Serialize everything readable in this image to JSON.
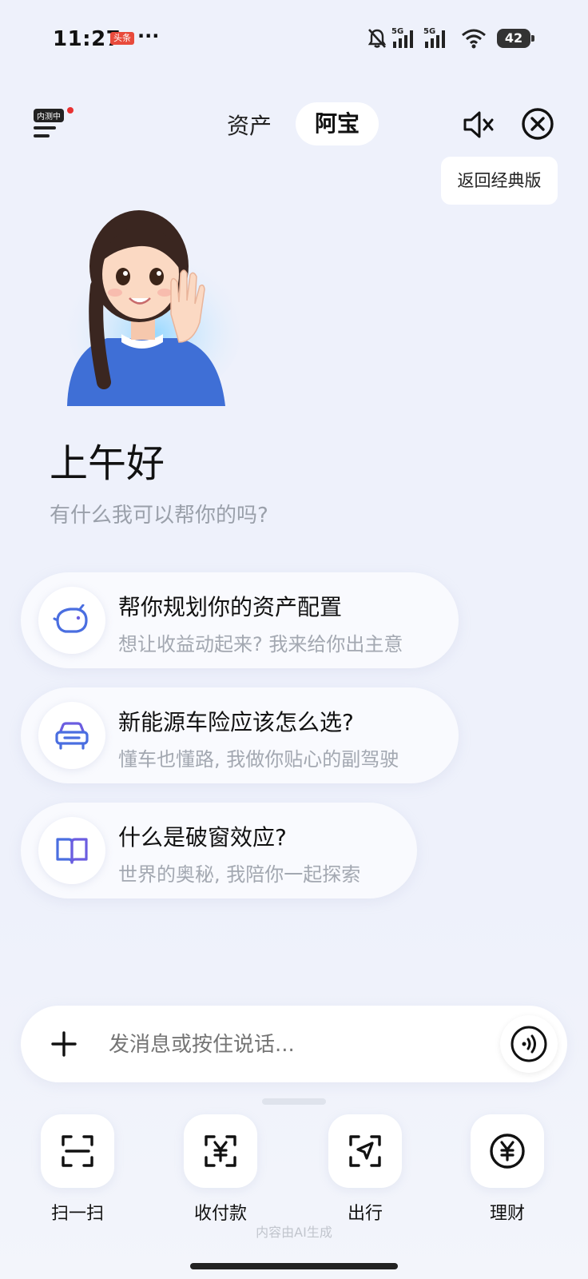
{
  "status": {
    "time": "11:27",
    "news_badge": "头条",
    "dots": "···",
    "battery": "42"
  },
  "nav": {
    "beta_badge": "内测中",
    "tab_assets": "资产",
    "tab_abao": "阿宝",
    "tooltip": "返回经典版"
  },
  "greeting": {
    "title": "上午好",
    "subtitle": "有什么我可以帮你的吗?"
  },
  "cards": [
    {
      "icon": "piggy-bank-icon",
      "title": "帮你规划你的资产配置",
      "subtitle": "想让收益动起来? 我来给你出主意"
    },
    {
      "icon": "car-icon",
      "title": "新能源车险应该怎么选?",
      "subtitle": "懂车也懂路, 我做你贴心的副驾驶"
    },
    {
      "icon": "book-icon",
      "title": "什么是破窗效应?",
      "subtitle": "世界的奥秘, 我陪你一起探索"
    }
  ],
  "input": {
    "placeholder": "发消息或按住说话..."
  },
  "shortcuts": [
    {
      "icon": "scan-icon",
      "label": "扫一扫"
    },
    {
      "icon": "payment-code-icon",
      "label": "收付款"
    },
    {
      "icon": "travel-icon",
      "label": "出行"
    },
    {
      "icon": "wealth-icon",
      "label": "理财"
    }
  ],
  "footer_note": "内容由AI生成",
  "colors": {
    "background": "#eef1fb",
    "icon_blue": "#4a6ee0",
    "icon_purple": "#6b5de0"
  }
}
